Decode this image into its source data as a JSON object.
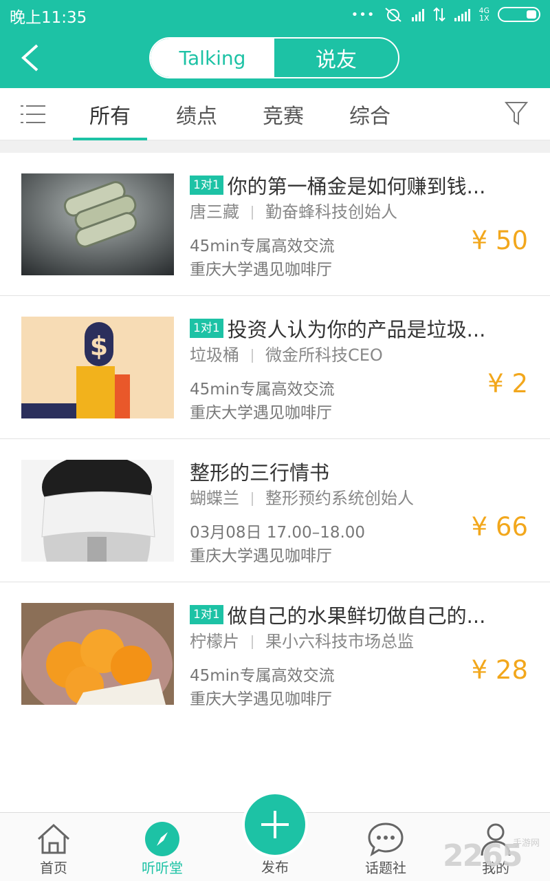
{
  "status": {
    "time": "晚上11:35",
    "network": [
      "4G",
      "1X"
    ]
  },
  "header": {
    "segments": [
      {
        "label": "Talking",
        "active": true
      },
      {
        "label": "说友",
        "active": false
      }
    ],
    "accent": "#1dc2a5"
  },
  "tabs": [
    {
      "label": "所有",
      "active": true
    },
    {
      "label": "绩点",
      "active": false
    },
    {
      "label": "竞赛",
      "active": false
    },
    {
      "label": "综合",
      "active": false
    }
  ],
  "items": [
    {
      "badge": "1对1",
      "title": "你的第一桶金是如何赚到钱...",
      "host": "唐三藏",
      "role": "勤奋蜂科技创始人",
      "time": "45min专属高效交流",
      "place": "重庆大学遇见咖啡厅",
      "price": "¥ 50"
    },
    {
      "badge": "1对1",
      "title": "投资人认为你的产品是垃圾...",
      "host": "垃圾桶",
      "role": "微金所科技CEO",
      "time": "45min专属高效交流",
      "place": "重庆大学遇见咖啡厅",
      "price": "¥ 2"
    },
    {
      "badge": "",
      "title": "整形的三行情书",
      "host": "蝴蝶兰",
      "role": "整形预约系统创始人",
      "time": "03月08日 17.00–18.00",
      "place": "重庆大学遇见咖啡厅",
      "price": "¥ 66"
    },
    {
      "badge": "1对1",
      "title": "做自己的水果鲜切做自己的...",
      "host": "柠檬片",
      "role": "果小六科技市场总监",
      "time": "45min专属高效交流",
      "place": "重庆大学遇见咖啡厅",
      "price": "¥ 28"
    }
  ],
  "nav": [
    {
      "label": "首页",
      "icon": "home-icon",
      "active": false
    },
    {
      "label": "听听堂",
      "icon": "compass-icon",
      "active": true
    },
    {
      "label": "发布",
      "icon": "plus-icon",
      "active": false
    },
    {
      "label": "话题社",
      "icon": "chat-icon",
      "active": false
    },
    {
      "label": "我的",
      "icon": "user-icon",
      "active": false
    }
  ],
  "watermark": {
    "number": "2265",
    "text": "手游网"
  }
}
